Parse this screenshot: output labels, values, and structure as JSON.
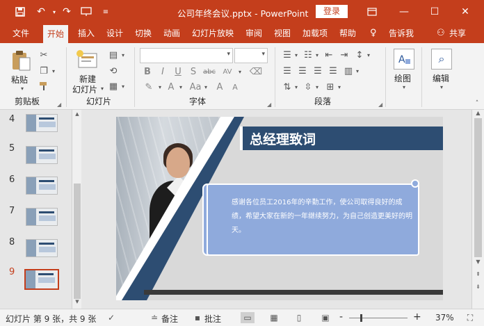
{
  "titlebar": {
    "title": "公司年终会议.pptx  -  PowerPoint",
    "login_label": "登录",
    "save_icon": "save-icon",
    "undo_icon": "undo-icon",
    "redo_icon": "redo-icon",
    "present_icon": "present-from-start-icon"
  },
  "tabs": [
    {
      "label": "文件"
    },
    {
      "label": "开始"
    },
    {
      "label": "插入"
    },
    {
      "label": "设计"
    },
    {
      "label": "切换"
    },
    {
      "label": "动画"
    },
    {
      "label": "幻灯片放映"
    },
    {
      "label": "审阅"
    },
    {
      "label": "视图"
    },
    {
      "label": "加载项"
    },
    {
      "label": "帮助"
    },
    {
      "label": "告诉我"
    },
    {
      "label": "共享"
    }
  ],
  "ribbon": {
    "paste_label": "粘贴",
    "new_slide_label": "新建",
    "new_slide_label2": "幻灯片",
    "clipboard_group": "剪贴板",
    "slides_group": "幻灯片",
    "font_group": "字体",
    "paragraph_group": "段落",
    "drawing_label": "绘图",
    "editing_label": "编辑",
    "font_buttons": {
      "bold": "B",
      "italic": "I",
      "underline": "U",
      "shadow": "S",
      "strike": "abc",
      "size_a": "Aa",
      "aa": "AV"
    }
  },
  "slides_pane": {
    "numbers": [
      "4",
      "5",
      "6",
      "7",
      "8",
      "9"
    ],
    "active": "9"
  },
  "slide": {
    "title": "总经理致词",
    "body": "感谢各位员工2016年的辛勤工作，使公司取得良好的成绩，希望大家在新的一年继续努力，为自己创造更美好的明天。"
  },
  "status": {
    "slide_info": "幻灯片 第 9 张，共 9 张",
    "notes_label": "备注",
    "comments_label": "批注",
    "zoom": "37%",
    "zoom_minus": "-",
    "zoom_plus": "+"
  },
  "colors": {
    "accent": "#c43e1c",
    "slide_title_band": "#2d4d72",
    "scroll_box": "#8faadc"
  }
}
